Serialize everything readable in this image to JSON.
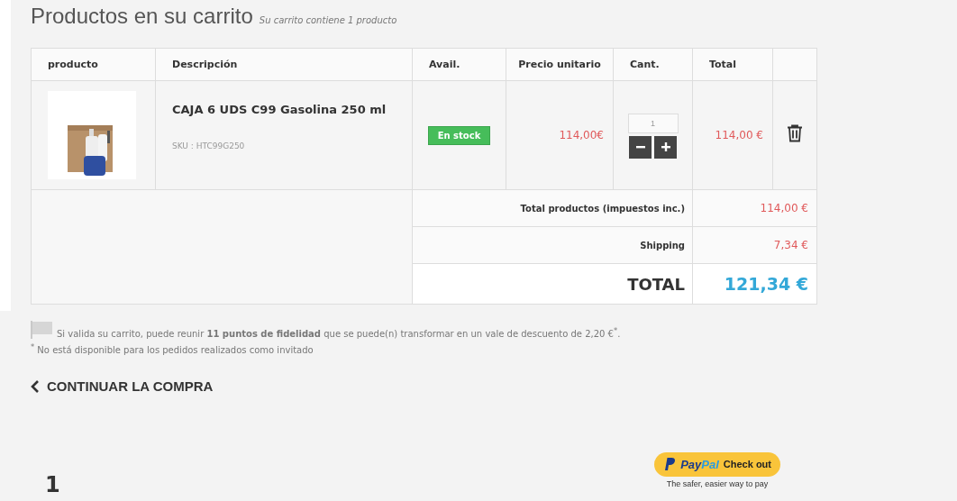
{
  "title": "Productos en su carrito",
  "subtitle": "Su carrito contiene 1 producto",
  "table": {
    "columns": [
      "producto",
      "Descripción",
      "Avail.",
      "Precio unitario",
      "Cant.",
      "Total"
    ],
    "rows": [
      {
        "name": "CAJA 6 UDS C99 Gasolina 250 ml",
        "sku": "SKU : HTC99G250",
        "availability": "En stock",
        "in_stock": true,
        "unit_price": "114,00€",
        "quantity": "1",
        "total": "114,00 €"
      }
    ],
    "summary": [
      {
        "kind": "line",
        "label": "Total productos (impuestos inc.)",
        "value": "114,00 €"
      },
      {
        "kind": "line",
        "label": "Shipping",
        "value": "7,34 €"
      },
      {
        "kind": "grand",
        "label": "TOTAL",
        "value": "121,34 €"
      }
    ]
  },
  "loyalty": {
    "message": "Si valida su carrito, puede reunir **11 puntos de fidelidad** que se puede(n) transformar en un vale de descuento de 2,20 €$^{*}$.",
    "note": "$^{*}$ No está disponible para los pedidos realizados como invitado"
  },
  "continue_link": "CONTINUAR LA COMPRA",
  "paypal": {
    "logo": [
      "Pay",
      "Pal"
    ],
    "label": "Check out",
    "tagline": "The safer, easier way to pay"
  },
  "step_number": "1"
}
